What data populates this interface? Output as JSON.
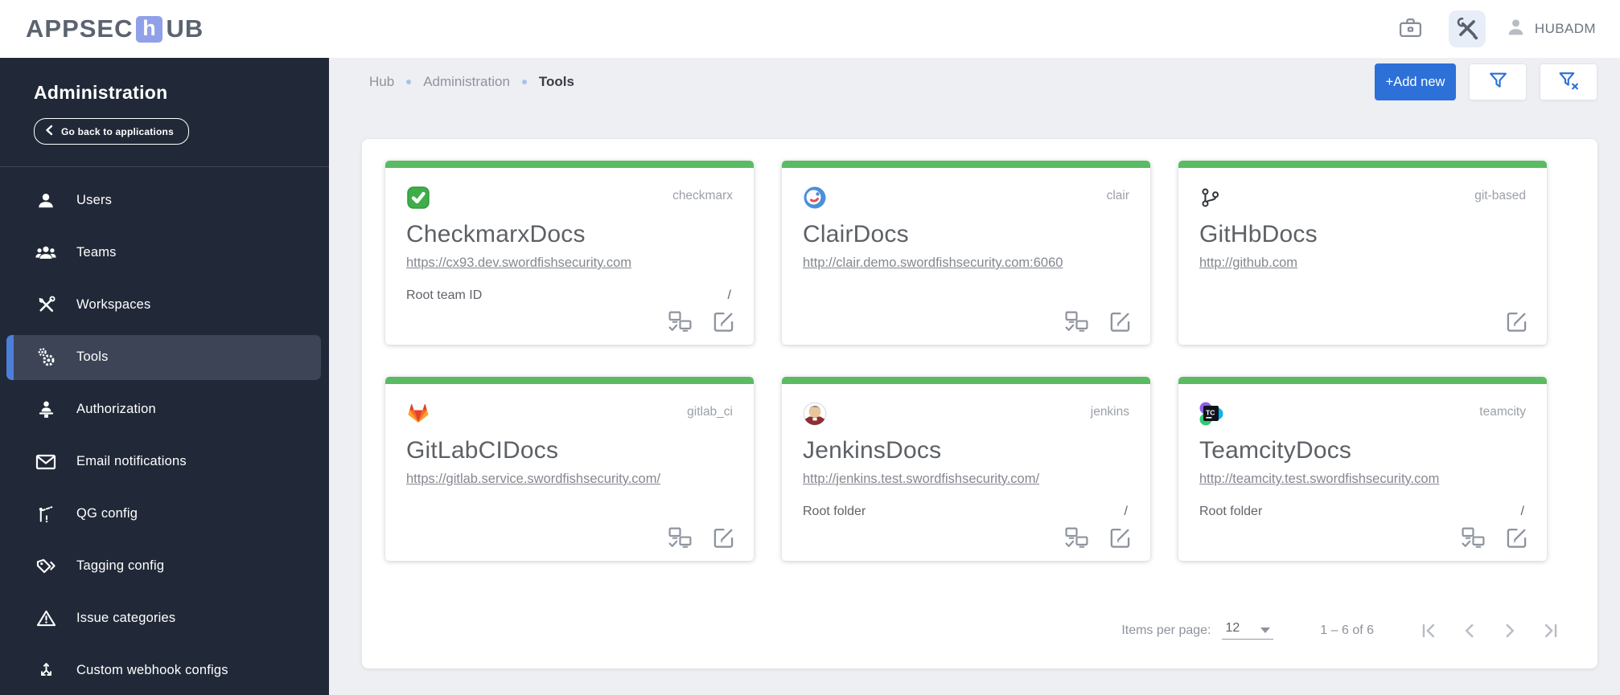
{
  "topbar": {
    "logo_prefix": "APPSEC",
    "logo_h": "h",
    "logo_suffix": "UB",
    "username": "HUBADM"
  },
  "sidebar": {
    "title": "Administration",
    "back_button_label": "Go back to applications",
    "items": [
      {
        "label": "Users",
        "selected": false
      },
      {
        "label": "Teams",
        "selected": false
      },
      {
        "label": "Workspaces",
        "selected": false
      },
      {
        "label": "Tools",
        "selected": true
      },
      {
        "label": "Authorization",
        "selected": false
      },
      {
        "label": "Email notifications",
        "selected": false
      },
      {
        "label": "QG config",
        "selected": false
      },
      {
        "label": "Tagging config",
        "selected": false
      },
      {
        "label": "Issue categories",
        "selected": false
      },
      {
        "label": "Custom webhook configs",
        "selected": false
      }
    ]
  },
  "breadcrumb": {
    "hub": "Hub",
    "section": "Administration",
    "current": "Tools"
  },
  "toolbar": {
    "add_new_label": "+Add new"
  },
  "cards": [
    {
      "title": "CheckmarxDocs",
      "vendor": "checkmarx",
      "url": "https://cx93.dev.swordfishsecurity.com",
      "root_label": "Root team ID",
      "root_value": "/",
      "has_health": true
    },
    {
      "title": "ClairDocs",
      "vendor": "clair",
      "url": "http://clair.demo.swordfishsecurity.com:6060",
      "root_label": "",
      "root_value": "",
      "has_health": true
    },
    {
      "title": "GitHbDocs",
      "vendor": "git-based",
      "url": "http://github.com",
      "root_label": "",
      "root_value": "",
      "has_health": false
    },
    {
      "title": "GitLabCIDocs",
      "vendor": "gitlab_ci",
      "url": "https://gitlab.service.swordfishsecurity.com/",
      "root_label": "",
      "root_value": "",
      "has_health": true
    },
    {
      "title": "JenkinsDocs",
      "vendor": "jenkins",
      "url": "http://jenkins.test.swordfishsecurity.com/",
      "root_label": "Root folder",
      "root_value": "/",
      "has_health": true
    },
    {
      "title": "TeamcityDocs",
      "vendor": "teamcity",
      "url": "http://teamcity.test.swordfishsecurity.com",
      "root_label": "Root folder",
      "root_value": "/",
      "has_health": true
    }
  ],
  "pagination": {
    "items_per_page_label": "Items per page:",
    "items_per_page_value": "12",
    "range_label": "1 – 6 of 6"
  },
  "colors": {
    "accent_green": "#5abb63",
    "accent_blue": "#2d70d8",
    "sidebar_bg": "#212938",
    "sidebar_selected_bg": "#3c4456",
    "sidebar_selected_border": "#4d7ed9",
    "main_bg": "#edeff3"
  }
}
